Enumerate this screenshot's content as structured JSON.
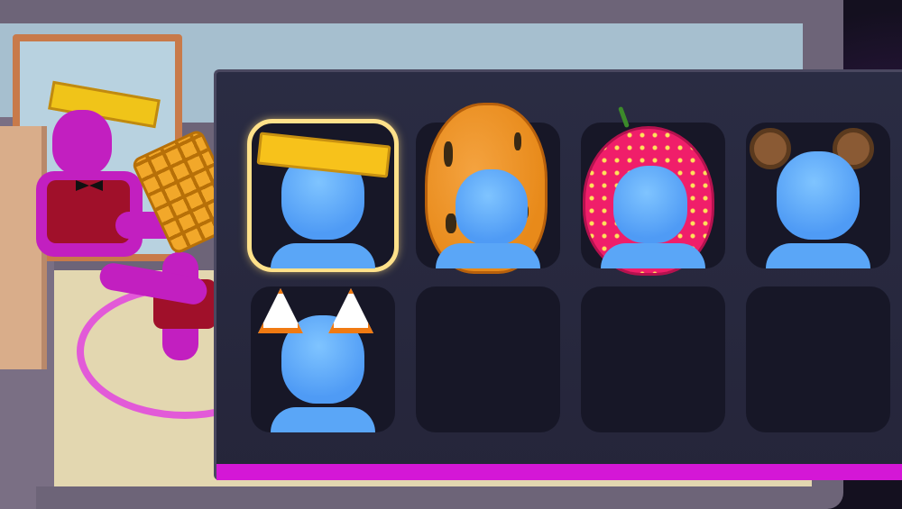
{
  "scene": {
    "description_elements": [
      "mirror",
      "stylist-character",
      "waffle",
      "placement-ring"
    ]
  },
  "inventory": {
    "selected_index": 0,
    "slots": [
      {
        "item": "golden-hat",
        "filled": true,
        "selected": true
      },
      {
        "item": "peanut-costume",
        "filled": true,
        "selected": false
      },
      {
        "item": "strawberry-costume",
        "filled": true,
        "selected": false
      },
      {
        "item": "bear-ears",
        "filled": true,
        "selected": false
      },
      {
        "item": "fox-ears",
        "filled": true,
        "selected": false
      },
      {
        "item": "empty",
        "filled": false,
        "selected": false
      },
      {
        "item": "empty",
        "filled": false,
        "selected": false
      },
      {
        "item": "empty",
        "filled": false,
        "selected": false
      }
    ]
  },
  "colors": {
    "accent": "#d417d6",
    "panel": "#2a2c43",
    "slot": "#171727",
    "selection": "#ffe18a",
    "avatar": "#5aa6f7"
  }
}
